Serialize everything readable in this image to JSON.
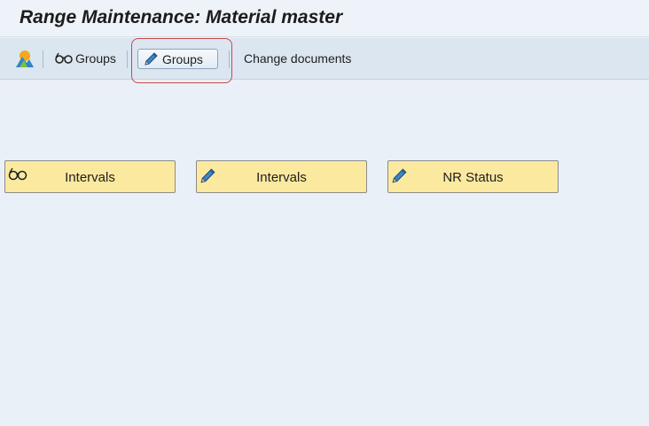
{
  "window": {
    "title": "Range Maintenance: Material master"
  },
  "toolbar": {
    "overview_icon": "overview-icon",
    "display_groups_label": "Groups",
    "change_groups_label": "Groups",
    "change_documents_label": "Change documents"
  },
  "main": {
    "buttons": [
      {
        "icon": "glasses-icon",
        "label": "Intervals"
      },
      {
        "icon": "pencil-icon",
        "label": "Intervals"
      },
      {
        "icon": "pencil-icon",
        "label": "NR Status"
      }
    ]
  },
  "colors": {
    "background": "#eaf0f7",
    "toolbar": "#dbe6f1",
    "button_fill": "#fbe9a0",
    "highlight": "#c9474b"
  }
}
